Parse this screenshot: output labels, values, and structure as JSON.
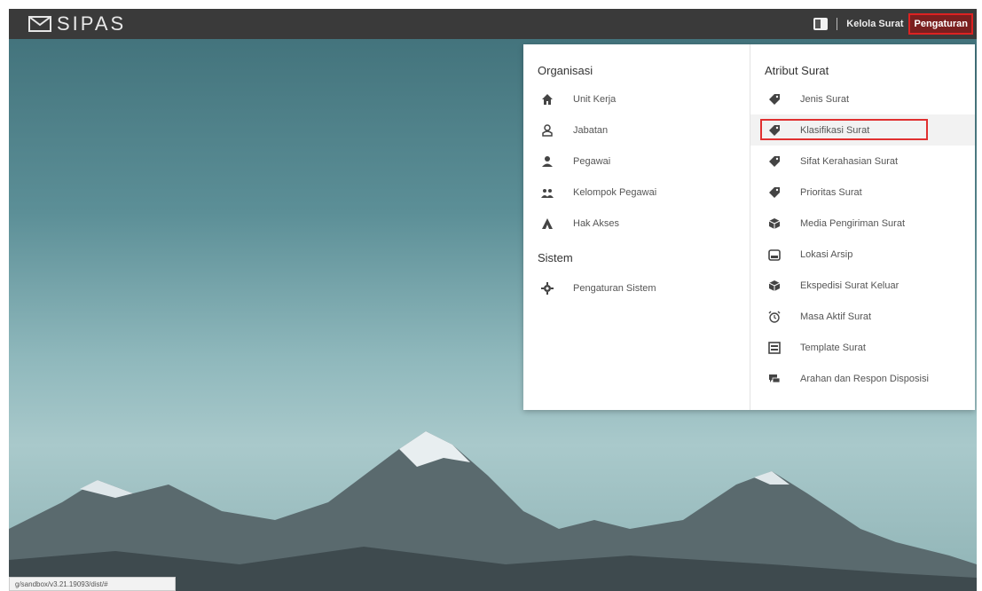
{
  "app": {
    "logo_text": "SIPAS"
  },
  "topnav": {
    "kelola_label": "Kelola Surat",
    "pengaturan_label": "Pengaturan"
  },
  "menu": {
    "organisasi": {
      "title": "Organisasi",
      "items": [
        {
          "label": "Unit Kerja",
          "icon": "home-icon"
        },
        {
          "label": "Jabatan",
          "icon": "user-badge-icon"
        },
        {
          "label": "Pegawai",
          "icon": "person-icon"
        },
        {
          "label": "Kelompok Pegawai",
          "icon": "group-icon"
        },
        {
          "label": "Hak Akses",
          "icon": "access-icon"
        }
      ]
    },
    "sistem": {
      "title": "Sistem",
      "items": [
        {
          "label": "Pengaturan Sistem",
          "icon": "gear-icon"
        }
      ]
    },
    "atribut": {
      "title": "Atribut Surat",
      "items": [
        {
          "label": "Jenis Surat",
          "icon": "tag-icon"
        },
        {
          "label": "Klasifikasi Surat",
          "icon": "tag-icon"
        },
        {
          "label": "Sifat Kerahasian Surat",
          "icon": "tag-icon"
        },
        {
          "label": "Prioritas Surat",
          "icon": "tag-icon"
        },
        {
          "label": "Media Pengiriman Surat",
          "icon": "box-icon"
        },
        {
          "label": "Lokasi Arsip",
          "icon": "archive-icon"
        },
        {
          "label": "Ekspedisi Surat Keluar",
          "icon": "box-icon"
        },
        {
          "label": "Masa Aktif Surat",
          "icon": "alarm-icon"
        },
        {
          "label": "Template Surat",
          "icon": "template-icon"
        },
        {
          "label": "Arahan dan Respon Disposisi",
          "icon": "chat-icon"
        }
      ]
    }
  },
  "status_bar": {
    "text": "g/sandbox/v3.21.19093/dist/#"
  },
  "colors": {
    "topbar": "#3a3a3a",
    "highlight_border": "#e03030",
    "active_tab": "#7a1f1f"
  }
}
